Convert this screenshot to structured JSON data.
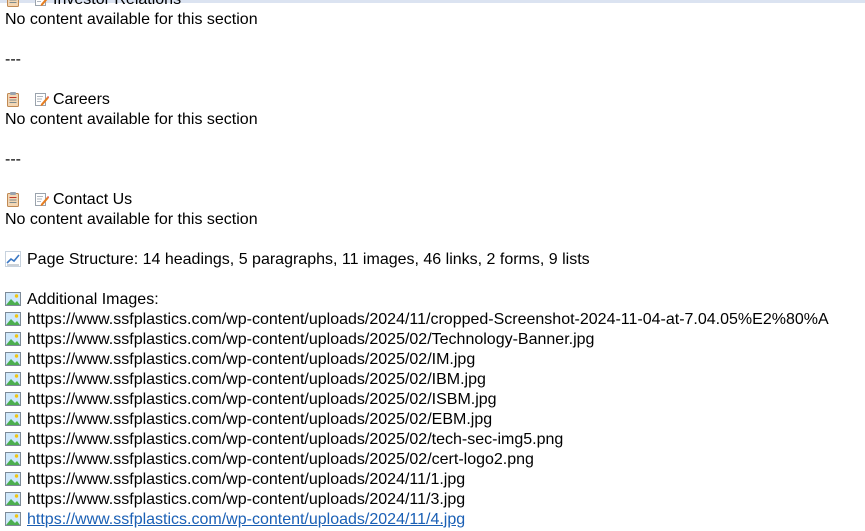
{
  "sections": [
    {
      "title": "Investor Relations",
      "message": "No content available for this section"
    },
    {
      "title": "Careers",
      "message": "No content available for this section"
    },
    {
      "title": "Contact Us",
      "message": "No content available for this section"
    }
  ],
  "separator": "---",
  "page_structure": "Page Structure: 14 headings, 5 paragraphs, 11 images, 46 links, 2 forms, 9 lists",
  "additional_images": {
    "label": "Additional Images:",
    "urls": [
      "https://www.ssfplastics.com/wp-content/uploads/2024/11/cropped-Screenshot-2024-11-04-at-7.04.05%E2%80%A",
      "https://www.ssfplastics.com/wp-content/uploads/2025/02/Technology-Banner.jpg",
      "https://www.ssfplastics.com/wp-content/uploads/2025/02/IM.jpg",
      "https://www.ssfplastics.com/wp-content/uploads/2025/02/IBM.jpg",
      "https://www.ssfplastics.com/wp-content/uploads/2025/02/ISBM.jpg",
      "https://www.ssfplastics.com/wp-content/uploads/2025/02/EBM.jpg",
      "https://www.ssfplastics.com/wp-content/uploads/2025/02/tech-sec-img5.png",
      "https://www.ssfplastics.com/wp-content/uploads/2025/02/cert-logo2.png",
      "https://www.ssfplastics.com/wp-content/uploads/2024/11/1.jpg",
      "https://www.ssfplastics.com/wp-content/uploads/2024/11/3.jpg",
      "https://www.ssfplastics.com/wp-content/uploads/2024/11/4.jpg"
    ]
  },
  "colors": {
    "link": "#1a5fb4",
    "top_border": "#dbe3f1"
  }
}
